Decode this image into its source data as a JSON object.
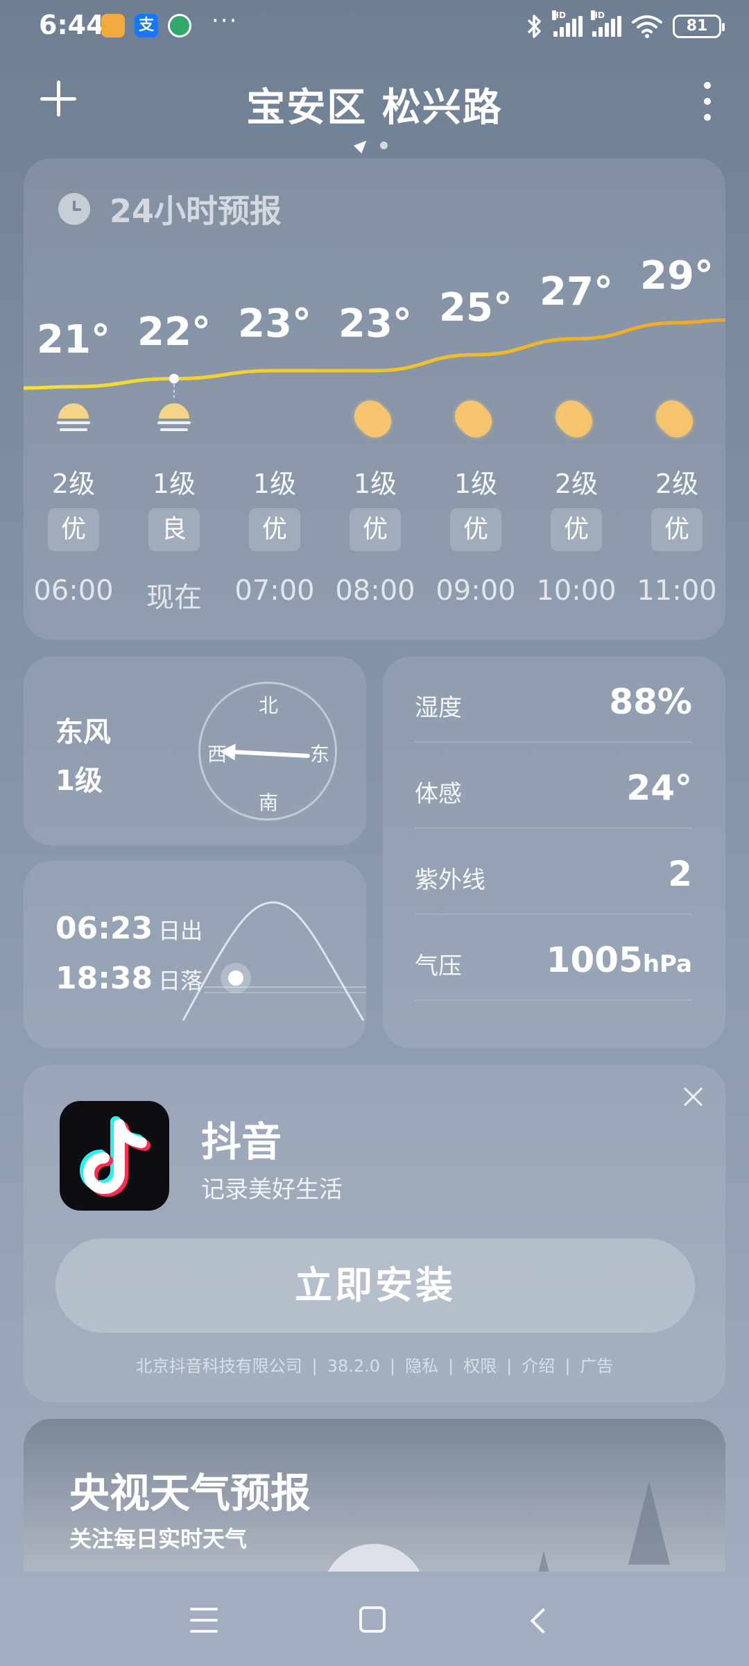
{
  "status_bar": {
    "time": "6:44",
    "app_icons": [
      "notes-icon",
      "alipay-icon",
      "bank-icon"
    ],
    "alipay_glyph": "支",
    "dots": "···",
    "signal1_label": "HD",
    "signal2_label": "HD",
    "battery": "81"
  },
  "header": {
    "location": "宝安区 松兴路"
  },
  "hourly": {
    "title": "24小时预报",
    "hours": [
      {
        "time": "06:00",
        "temp": "21°",
        "temp_value": 21,
        "icon": "moon-half-icon",
        "wind": "2级",
        "aqi": "优"
      },
      {
        "time": "现在",
        "temp": "22°",
        "temp_value": 22,
        "icon": "moon-half-icon",
        "wind": "1级",
        "aqi": "良"
      },
      {
        "time": "07:00",
        "temp": "23°",
        "temp_value": 23,
        "icon": "partly-cloudy-icon",
        "wind": "1级",
        "aqi": "优"
      },
      {
        "time": "08:00",
        "temp": "23°",
        "temp_value": 23,
        "icon": "sun-icon",
        "wind": "1级",
        "aqi": "优"
      },
      {
        "time": "09:00",
        "temp": "25°",
        "temp_value": 25,
        "icon": "sun-icon",
        "wind": "1级",
        "aqi": "优"
      },
      {
        "time": "10:00",
        "temp": "27°",
        "temp_value": 27,
        "icon": "sun-icon",
        "wind": "2级",
        "aqi": "优"
      },
      {
        "time": "11:00",
        "temp": "29°",
        "temp_value": 29,
        "icon": "sun-icon",
        "wind": "2级",
        "aqi": "优"
      }
    ]
  },
  "wind": {
    "direction": "东风",
    "level": "1级",
    "compass": {
      "north": "北",
      "south": "南",
      "east": "东",
      "west": "西"
    }
  },
  "sun": {
    "sunrise_time": "06:23",
    "sunrise_label": "日出",
    "sunset_time": "18:38",
    "sunset_label": "日落"
  },
  "details": [
    {
      "label": "湿度",
      "value": "88%",
      "unit": ""
    },
    {
      "label": "体感",
      "value": "24°",
      "unit": ""
    },
    {
      "label": "紫外线",
      "value": "2",
      "unit": ""
    },
    {
      "label": "气压",
      "value": "1005",
      "unit": "hPa"
    }
  ],
  "ad": {
    "app_name": "抖音",
    "slogan": "记录美好生活",
    "install_label": "立即安装",
    "footer": [
      "北京抖音科技有限公司",
      "38.2.0",
      "隐私",
      "权限",
      "介绍",
      "广告"
    ]
  },
  "cctv": {
    "title": "央视天气预报",
    "subtitle": "关注每日实时天气"
  },
  "colors": {
    "temp_line_start": "#f2e233",
    "temp_line_end": "#f0a623",
    "sun": "#f6c46f"
  }
}
